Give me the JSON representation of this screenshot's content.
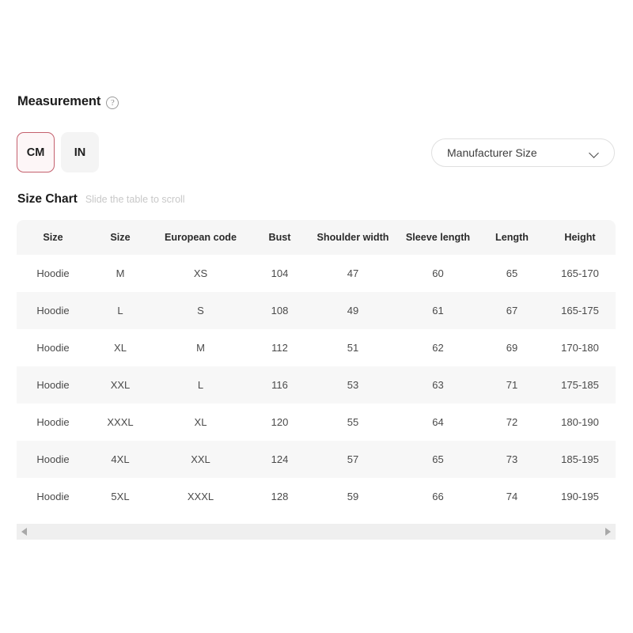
{
  "measurement": {
    "title": "Measurement",
    "help_icon": "question-circle-icon"
  },
  "unit_toggle": {
    "options": [
      {
        "label": "CM",
        "active": true
      },
      {
        "label": "IN",
        "active": false
      }
    ],
    "active_border_color": "#c4606d",
    "active_fill_color": "#fdf6f7",
    "inactive_fill_color": "#f4f4f4"
  },
  "size_select": {
    "value": "Manufacturer Size",
    "chevron_icon": "chevron-down-icon"
  },
  "size_chart": {
    "title": "Size Chart",
    "hint": "Slide the table to scroll",
    "columns": [
      "Size",
      "Size",
      "European code",
      "Bust",
      "Shoulder width",
      "Sleeve length",
      "Length",
      "Height"
    ],
    "rows": [
      [
        "Hoodie",
        "M",
        "XS",
        "104",
        "47",
        "60",
        "65",
        "165-170"
      ],
      [
        "Hoodie",
        "L",
        "S",
        "108",
        "49",
        "61",
        "67",
        "165-175"
      ],
      [
        "Hoodie",
        "XL",
        "M",
        "112",
        "51",
        "62",
        "69",
        "170-180"
      ],
      [
        "Hoodie",
        "XXL",
        "L",
        "116",
        "53",
        "63",
        "71",
        "175-185"
      ],
      [
        "Hoodie",
        "XXXL",
        "XL",
        "120",
        "55",
        "64",
        "72",
        "180-190"
      ],
      [
        "Hoodie",
        "4XL",
        "XXL",
        "124",
        "57",
        "65",
        "73",
        "185-195"
      ],
      [
        "Hoodie",
        "5XL",
        "XXXL",
        "128",
        "59",
        "66",
        "74",
        "190-195"
      ]
    ],
    "header_bg": "#f6f6f6",
    "row_alt_bg": "#f7f7f7"
  },
  "scrollbar": {
    "left_arrow_icon": "arrow-left-icon",
    "right_arrow_icon": "arrow-right-icon",
    "track_color": "#efefef"
  }
}
